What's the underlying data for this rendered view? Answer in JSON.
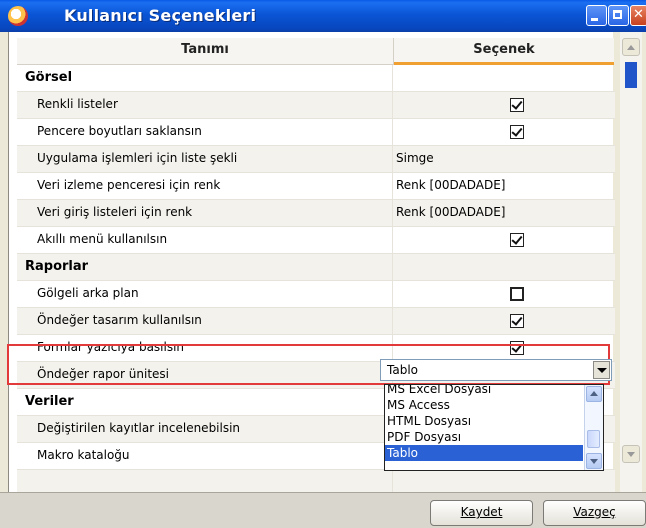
{
  "window": {
    "title": "Kullanıcı Seçenekleri",
    "icon": "app-orb-icon"
  },
  "columns": {
    "name": "Tanımı",
    "value": "Seçenek"
  },
  "rows": [
    {
      "type": "group",
      "label": "Görsel"
    },
    {
      "type": "check",
      "label": "Renkli listeler",
      "checked": true
    },
    {
      "type": "check",
      "label": "Pencere boyutları saklansın",
      "checked": true
    },
    {
      "type": "text",
      "label": "Uygulama işlemleri için liste şekli",
      "value": "Simge"
    },
    {
      "type": "text",
      "label": "Veri izleme penceresi için renk",
      "value": "Renk [00DADADE]"
    },
    {
      "type": "text",
      "label": "Veri giriş listeleri için renk",
      "value": "Renk [00DADADE]"
    },
    {
      "type": "check",
      "label": "Akıllı menü kullanılsın",
      "checked": true
    },
    {
      "type": "group",
      "label": "Raporlar"
    },
    {
      "type": "check",
      "label": "Gölgeli arka plan",
      "checked": false
    },
    {
      "type": "check",
      "label": "Öndeğer tasarım kullanılsın",
      "checked": true
    },
    {
      "type": "check",
      "label": "Formlar yazıcıya basılsın",
      "checked": true
    },
    {
      "type": "combo",
      "label": "Öndeğer rapor ünitesi",
      "value": "Tablo"
    },
    {
      "type": "group",
      "label": "Veriler"
    },
    {
      "type": "plain",
      "label": "Değiştirilen kayıtlar incelenebilsin"
    },
    {
      "type": "plain",
      "label": "Makro kataloğu"
    },
    {
      "type": "plain",
      "label": ""
    }
  ],
  "dropdown": {
    "options": [
      "MS Excel Dosyası",
      "MS Access",
      "HTML Dosyası",
      "PDF Dosyası",
      "Tablo"
    ],
    "selected": "Tablo"
  },
  "buttons": {
    "save": "Kaydet",
    "cancel": "Vazgeç"
  },
  "colors": {
    "titlebar": "#0a55d6",
    "highlight_box": "#e23a3a",
    "selection": "#2a62d6",
    "header_accent": "#f0a030"
  }
}
